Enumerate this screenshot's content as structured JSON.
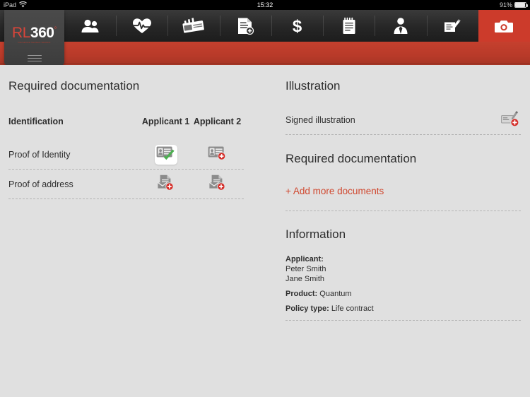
{
  "status_bar": {
    "device": "iPad",
    "wifi_icon": "wifi-icon",
    "time": "15:32",
    "battery_percent": "91%",
    "battery_level": 91
  },
  "brand": {
    "logo_rl": "RL",
    "logo_360": "360",
    "logo_dot": "°",
    "tagline": "International Insurance Solutions",
    "menu_icon": "hamburger-menu-icon"
  },
  "nav_tabs": [
    {
      "name": "tab-clients",
      "icon": "people-icon",
      "active": false
    },
    {
      "name": "tab-health",
      "icon": "heart-pulse-icon",
      "active": false
    },
    {
      "name": "tab-payment",
      "icon": "card-icon",
      "active": false
    },
    {
      "name": "tab-application",
      "icon": "document-add-icon",
      "active": false
    },
    {
      "name": "tab-premium",
      "icon": "dollar-icon",
      "active": false
    },
    {
      "name": "tab-notes",
      "icon": "notepad-icon",
      "active": false
    },
    {
      "name": "tab-adviser",
      "icon": "person-tie-icon",
      "active": false
    },
    {
      "name": "tab-declaration",
      "icon": "sign-document-icon",
      "active": false
    },
    {
      "name": "tab-documents",
      "icon": "camera-icon",
      "active": true
    }
  ],
  "left_panel": {
    "heading": "Required documentation",
    "columns": [
      "Identification",
      "Applicant 1",
      "Applicant 2"
    ],
    "rows": [
      {
        "label": "Proof of Identity",
        "applicant_1": {
          "icon": "id-card-icon",
          "state": "complete",
          "badge": "check-badge"
        },
        "applicant_2": {
          "icon": "id-card-icon",
          "state": "missing",
          "badge": "plus-badge"
        }
      },
      {
        "label": "Proof of address",
        "applicant_1": {
          "icon": "document-mail-icon",
          "state": "missing",
          "badge": "plus-badge"
        },
        "applicant_2": {
          "icon": "document-mail-icon",
          "state": "missing",
          "badge": "plus-badge"
        }
      }
    ]
  },
  "right_panel": {
    "illustration_heading": "Illustration",
    "illustration_row": {
      "label": "Signed illustration",
      "icon": "sign-document-icon",
      "badge": "plus-badge"
    },
    "required_heading": "Required documentation",
    "add_documents_link": "+ Add more documents",
    "information_heading": "Information",
    "info": {
      "applicant_label": "Applicant:",
      "applicants": [
        "Peter Smith",
        "Jane Smith"
      ],
      "product_label": "Product:",
      "product_value": "Quantum",
      "policy_label": "Policy type:",
      "policy_value": "Life contract"
    }
  },
  "colors": {
    "brand_red": "#c5402e",
    "accent_red": "#d0482f",
    "badge_red": "#d42a25",
    "check_green": "#4caf50",
    "content_bg": "#e0e0e0",
    "nav_dark": "#262626"
  }
}
